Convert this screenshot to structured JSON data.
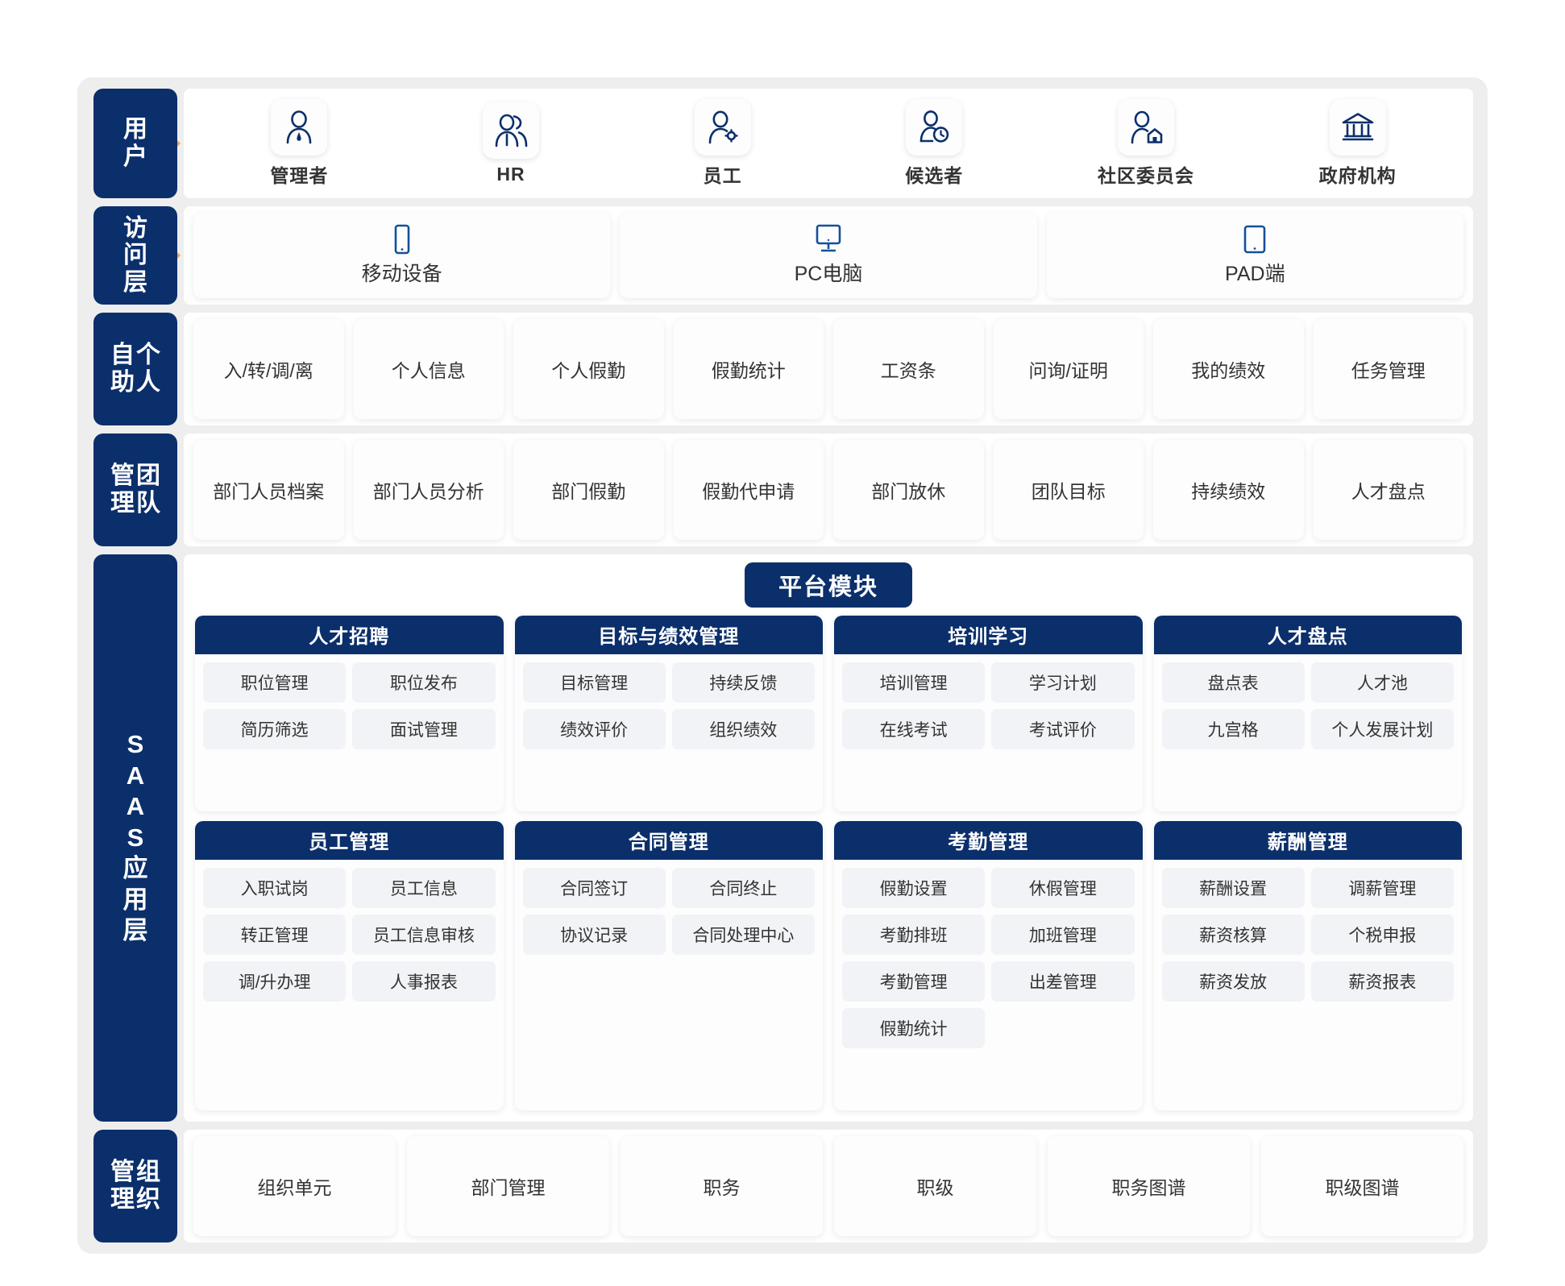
{
  "theme": {
    "navy": "#0b2f6b",
    "arrow_orange": "#f5a04a",
    "frame_gray": "#eeeeee",
    "card_white": "#fdfdfd",
    "sub_gray": "#f1f3f6",
    "text_dark": "#333333"
  },
  "rows": {
    "users": {
      "side_label": "用户",
      "side_cols": [
        "用",
        "户"
      ],
      "items": [
        {
          "label": "管理者",
          "icon": "user-single-icon"
        },
        {
          "label": "HR",
          "icon": "user-group-icon"
        },
        {
          "label": "员工",
          "icon": "user-gear-icon"
        },
        {
          "label": "候选者",
          "icon": "user-clock-icon"
        },
        {
          "label": "社区委员会",
          "icon": "user-home-icon"
        },
        {
          "label": "政府机构",
          "icon": "government-bank-icon"
        }
      ]
    },
    "access": {
      "side_label": "访问层",
      "side_cols": [
        "访",
        "问",
        "层"
      ],
      "items": [
        {
          "label": "移动设备",
          "icon": "mobile-phone-icon"
        },
        {
          "label": "PC电脑",
          "icon": "desktop-monitor-icon"
        },
        {
          "label": "PAD端",
          "icon": "tablet-icon"
        }
      ]
    },
    "self_service": {
      "side_label": "个人自助",
      "side_col_a": [
        "个",
        "人"
      ],
      "side_col_b": [
        "自",
        "助"
      ],
      "items": [
        "入/转/调/离",
        "个人信息",
        "个人假勤",
        "假勤统计",
        "工资条",
        "问询/证明",
        "我的绩效",
        "任务管理"
      ]
    },
    "team": {
      "side_label": "团队管理",
      "side_col_a": [
        "团",
        "队"
      ],
      "side_col_b": [
        "管",
        "理"
      ],
      "items": [
        "部门人员档案",
        "部门人员分析",
        "部门假勤",
        "假勤代申请",
        "部门放休",
        "团队目标",
        "持续绩效",
        "人才盘点"
      ]
    },
    "saas": {
      "side_label": "SAAS应用层",
      "side_chars": [
        "S",
        "A",
        "A",
        "S",
        "应",
        "用",
        "层"
      ],
      "platform_title": "平台模块",
      "modules": [
        {
          "title": "人才招聘",
          "items": [
            "职位管理",
            "职位发布",
            "简历筛选",
            "面试管理"
          ]
        },
        {
          "title": "目标与绩效管理",
          "items": [
            "目标管理",
            "持续反馈",
            "绩效评价",
            "组织绩效"
          ]
        },
        {
          "title": "培训学习",
          "items": [
            "培训管理",
            "学习计划",
            "在线考试",
            "考试评价"
          ]
        },
        {
          "title": "人才盘点",
          "items": [
            "盘点表",
            "人才池",
            "九宫格",
            "个人发展计划"
          ]
        },
        {
          "title": "员工管理",
          "items": [
            "入职试岗",
            "员工信息",
            "转正管理",
            "员工信息审核",
            "调/升办理",
            "人事报表"
          ]
        },
        {
          "title": "合同管理",
          "items": [
            "合同签订",
            "合同终止",
            "协议记录",
            "合同处理中心"
          ]
        },
        {
          "title": "考勤管理",
          "items": [
            "假勤设置",
            "休假管理",
            "考勤排班",
            "加班管理",
            "考勤管理",
            "出差管理",
            "假勤统计"
          ]
        },
        {
          "title": "薪酬管理",
          "items": [
            "薪酬设置",
            "调薪管理",
            "薪资核算",
            "个税申报",
            "薪资发放",
            "薪资报表"
          ]
        }
      ]
    },
    "organization": {
      "side_label": "组织管理",
      "side_col_a": [
        "组",
        "织"
      ],
      "side_col_b": [
        "管",
        "理"
      ],
      "items": [
        "组织单元",
        "部门管理",
        "职务",
        "职级",
        "职务图谱",
        "职级图谱"
      ]
    }
  }
}
